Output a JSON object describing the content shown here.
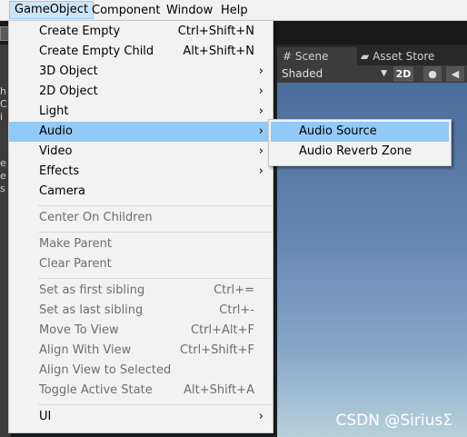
{
  "menubar": {
    "items": [
      "GameObject",
      "Component",
      "Window",
      "Help"
    ]
  },
  "left_strip": {
    "letters": [
      "h",
      "C",
      "i",
      "i",
      "",
      "e",
      "e",
      "s"
    ]
  },
  "scene": {
    "tabs": [
      {
        "label": "Scene",
        "icon": "hash-icon"
      },
      {
        "label": "Asset Store",
        "icon": "store-bag-icon"
      }
    ],
    "shading_mode": "Shaded",
    "mode_2d_label": "2D"
  },
  "gameobject_menu": {
    "items": [
      {
        "label": "Create Empty",
        "shortcut": "Ctrl+Shift+N",
        "submenu": false,
        "enabled": true
      },
      {
        "label": "Create Empty Child",
        "shortcut": "Alt+Shift+N",
        "submenu": false,
        "enabled": true
      },
      {
        "label": "3D Object",
        "shortcut": "",
        "submenu": true,
        "enabled": true
      },
      {
        "label": "2D Object",
        "shortcut": "",
        "submenu": true,
        "enabled": true
      },
      {
        "label": "Light",
        "shortcut": "",
        "submenu": true,
        "enabled": true
      },
      {
        "label": "Audio",
        "shortcut": "",
        "submenu": true,
        "enabled": true,
        "highlighted": true
      },
      {
        "label": "Video",
        "shortcut": "",
        "submenu": true,
        "enabled": true
      },
      {
        "label": "Effects",
        "shortcut": "",
        "submenu": true,
        "enabled": true
      },
      {
        "label": "Camera",
        "shortcut": "",
        "submenu": false,
        "enabled": true
      },
      {
        "label": "Center On Children",
        "shortcut": "",
        "submenu": false,
        "enabled": false
      },
      {
        "label": "Make Parent",
        "shortcut": "",
        "submenu": false,
        "enabled": false
      },
      {
        "label": "Clear Parent",
        "shortcut": "",
        "submenu": false,
        "enabled": false
      },
      {
        "label": "Set as first sibling",
        "shortcut": "Ctrl+=",
        "submenu": false,
        "enabled": false
      },
      {
        "label": "Set as last sibling",
        "shortcut": "Ctrl+-",
        "submenu": false,
        "enabled": false
      },
      {
        "label": "Move To View",
        "shortcut": "Ctrl+Alt+F",
        "submenu": false,
        "enabled": false
      },
      {
        "label": "Align With View",
        "shortcut": "Ctrl+Shift+F",
        "submenu": false,
        "enabled": false
      },
      {
        "label": "Align View to Selected",
        "shortcut": "",
        "submenu": false,
        "enabled": false
      },
      {
        "label": "Toggle Active State",
        "shortcut": "Alt+Shift+A",
        "submenu": false,
        "enabled": false
      },
      {
        "label": "UI",
        "shortcut": "",
        "submenu": true,
        "enabled": true
      }
    ],
    "arrow_glyph": "›"
  },
  "audio_submenu": {
    "items": [
      {
        "label": "Audio Source",
        "highlighted": true
      },
      {
        "label": "Audio Reverb Zone",
        "highlighted": false
      }
    ]
  },
  "watermark": "CSDN @SiriusΣ"
}
